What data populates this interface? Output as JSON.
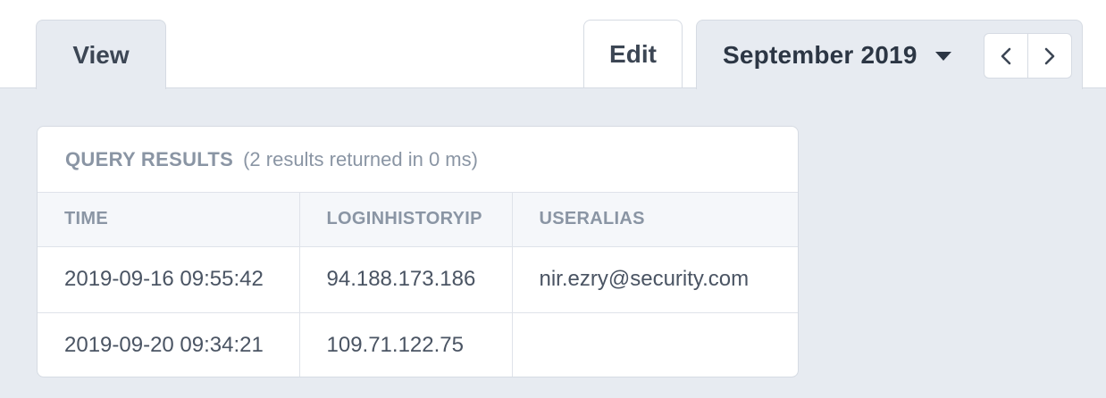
{
  "tabs": {
    "view_label": "View",
    "edit_label": "Edit"
  },
  "period": {
    "month_label": "September 2019",
    "prev_icon": "chevron-left-icon",
    "next_icon": "chevron-right-icon",
    "dropdown_icon": "caret-down-icon"
  },
  "query": {
    "title": "QUERY RESULTS",
    "summary": "(2 results returned in 0 ms)",
    "columns": [
      "TIME",
      "LOGINHISTORYIP",
      "USERALIAS"
    ],
    "rows": [
      [
        "2019-09-16 09:55:42",
        "94.188.173.186",
        "nir.ezry@security.com"
      ],
      [
        "2019-09-20 09:34:21",
        "109.71.122.75",
        ""
      ]
    ]
  },
  "colors": {
    "panel_background": "#e7ebf1",
    "border": "#d6dbe3",
    "muted_text": "#8a95a4",
    "body_text": "#4a5463"
  }
}
